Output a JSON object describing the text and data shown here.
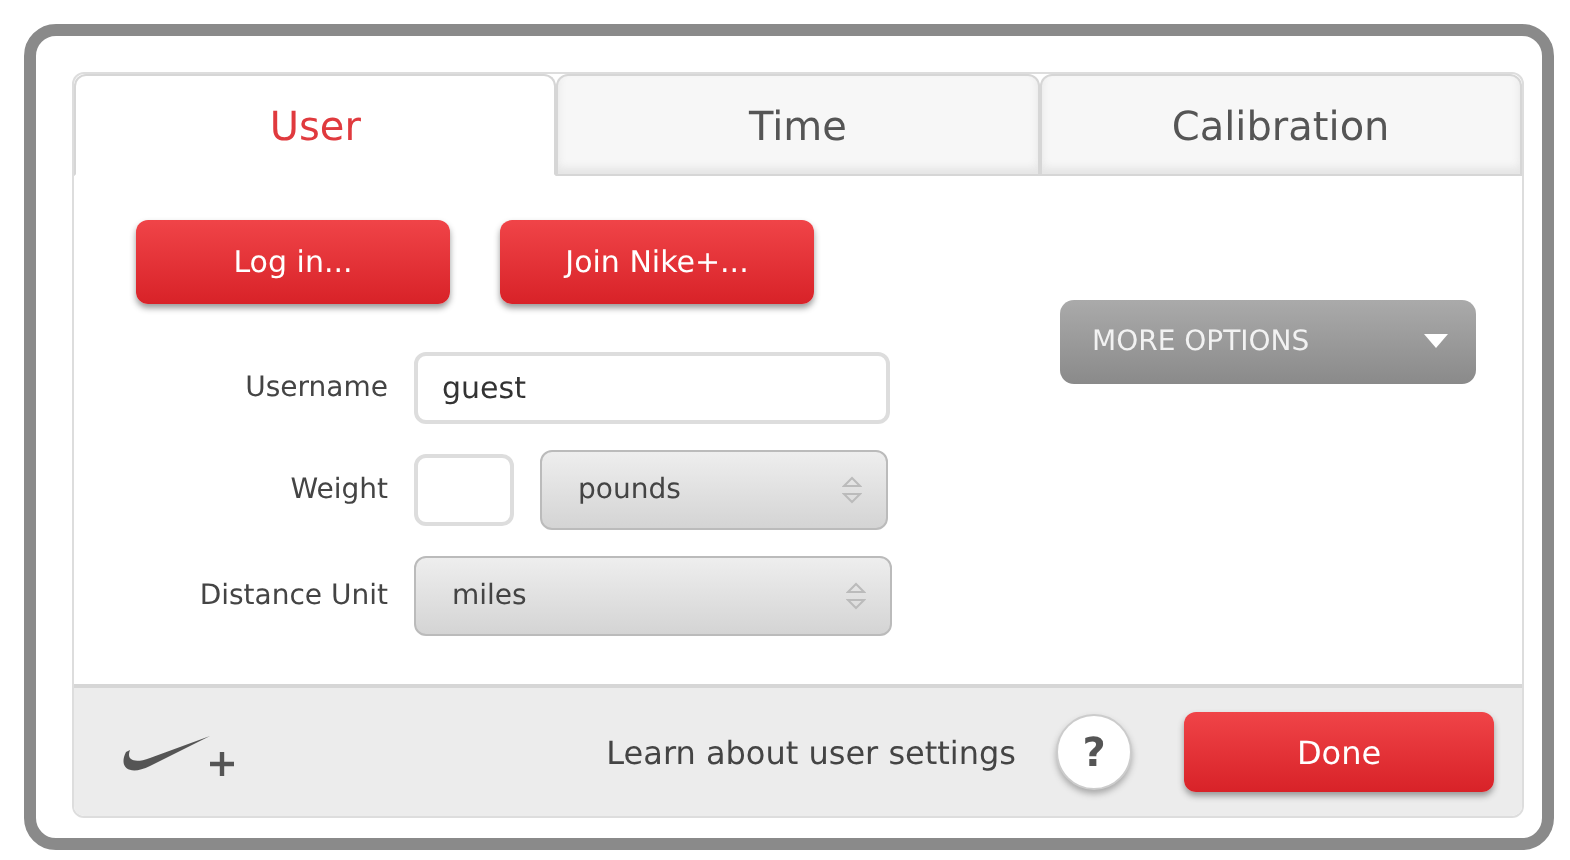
{
  "tabs": [
    {
      "label": "User",
      "selected": true
    },
    {
      "label": "Time",
      "selected": false
    },
    {
      "label": "Calibration",
      "selected": false
    }
  ],
  "buttons": {
    "login": "Log in...",
    "join": "Join Nike+...",
    "more_options": "MORE OPTIONS"
  },
  "form": {
    "username": {
      "label": "Username",
      "value": "guest"
    },
    "weight": {
      "label": "Weight",
      "value_unit": "pounds"
    },
    "distance_unit": {
      "label": "Distance Unit",
      "value": "miles"
    }
  },
  "footer": {
    "help_text": "Learn about user settings",
    "help_button": "?",
    "done": "Done"
  }
}
